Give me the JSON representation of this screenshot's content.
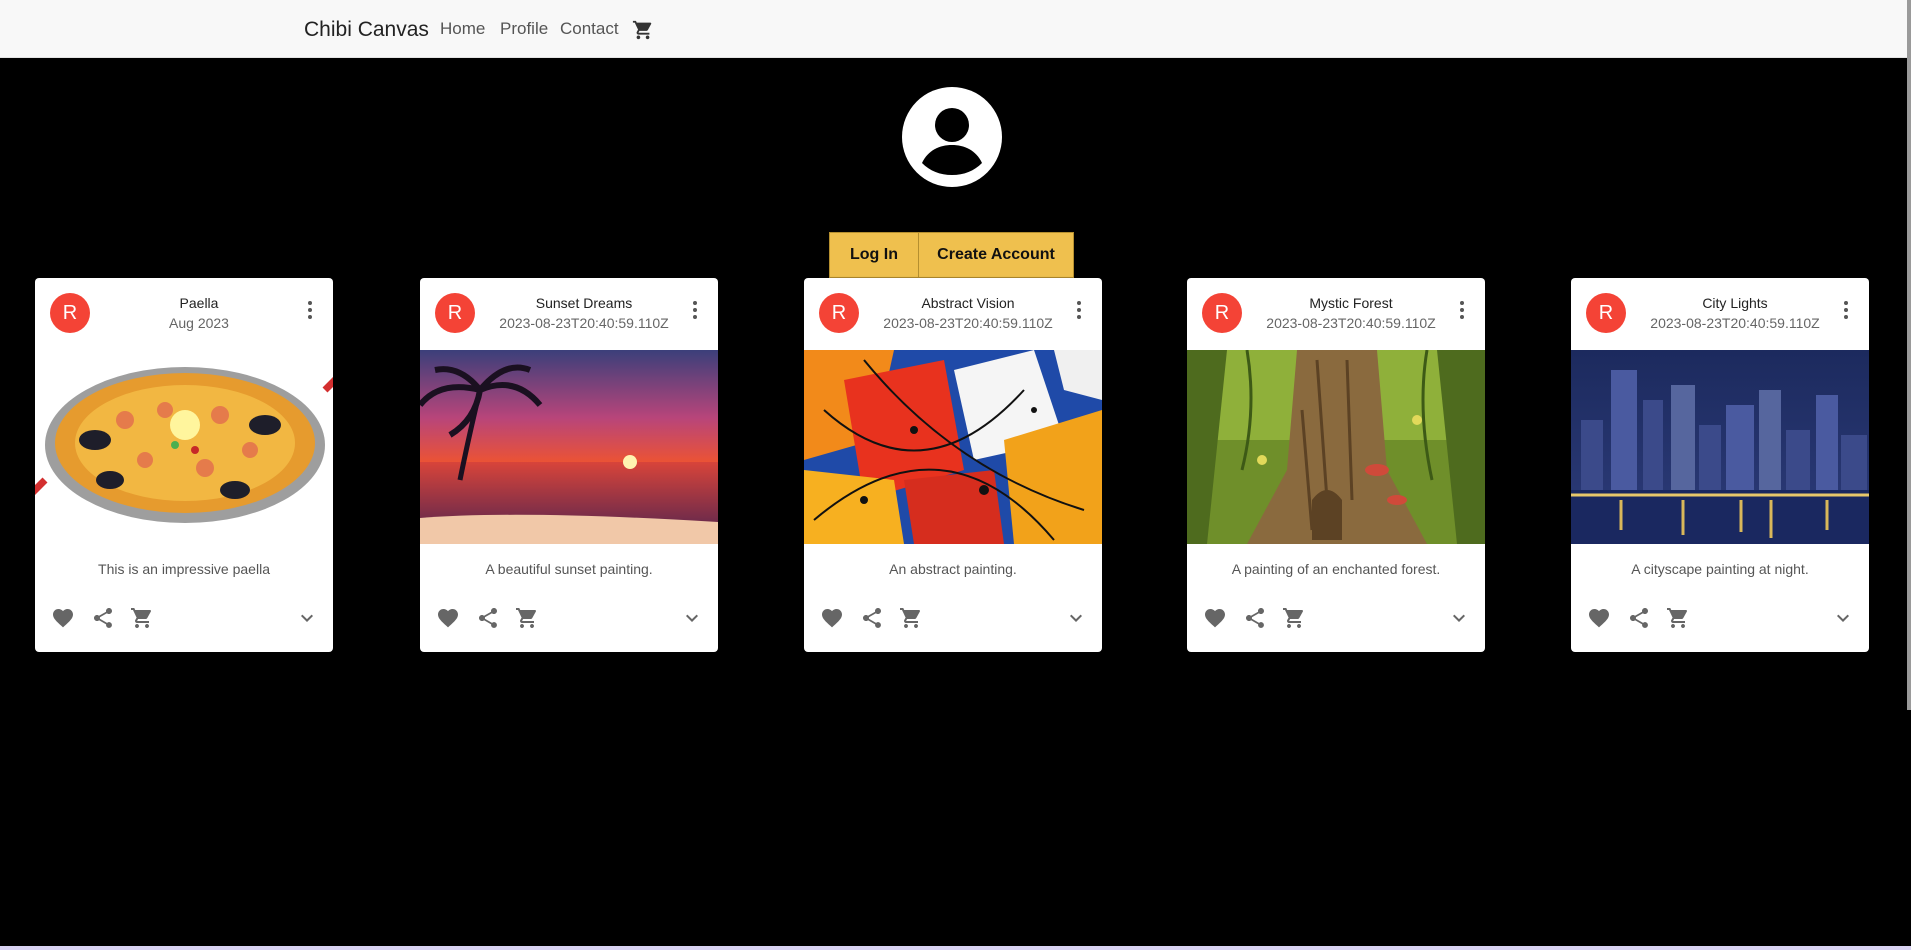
{
  "nav": {
    "brand": "Chibi Canvas",
    "links": [
      "Home",
      "Profile",
      "Contact"
    ],
    "cart_icon": "cart-icon"
  },
  "profile": {
    "avatar_icon": "account-circle-icon"
  },
  "auth": {
    "login": "Log In",
    "create": "Create Account"
  },
  "colors": {
    "accent": "#efc04e",
    "avatar": "#f44336",
    "background": "#000000"
  },
  "cards": [
    {
      "avatar": "R",
      "title": "Paella",
      "date": "Aug 2023",
      "description": "This is an impressive paella"
    },
    {
      "avatar": "R",
      "title": "Sunset Dreams",
      "date": "2023-08-23T20:40:59.110Z",
      "description": "A beautiful sunset painting."
    },
    {
      "avatar": "R",
      "title": "Abstract Vision",
      "date": "2023-08-23T20:40:59.110Z",
      "description": "An abstract painting."
    },
    {
      "avatar": "R",
      "title": "Mystic Forest",
      "date": "2023-08-23T20:40:59.110Z",
      "description": "A painting of an enchanted forest."
    },
    {
      "avatar": "R",
      "title": "City Lights",
      "date": "2023-08-23T20:40:59.110Z",
      "description": "A cityscape painting at night."
    }
  ]
}
